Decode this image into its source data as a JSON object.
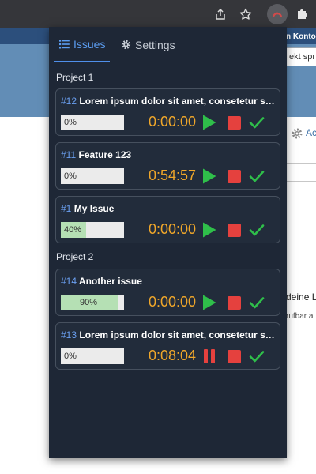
{
  "browser": {
    "icons": [
      "share-icon",
      "star-icon",
      "extension-icon",
      "puzzle-icon"
    ]
  },
  "page": {
    "header_link": "n Konto",
    "search_value": "ekt spr",
    "settings_link": "Ac",
    "text_line1": "deine L",
    "text_line2": "rufbar a"
  },
  "tabs": {
    "issues": "Issues",
    "settings": "Settings"
  },
  "projects": [
    {
      "name": "Project 1",
      "issues": [
        {
          "number": "#12",
          "title": "Lorem ipsum dolor sit amet, consetetur sadipscing elitr",
          "progress": 0,
          "progress_label": "0%",
          "time": "0:00:00",
          "running": false
        },
        {
          "number": "#11",
          "title": "Feature 123",
          "progress": 0,
          "progress_label": "0%",
          "time": "0:54:57",
          "running": false
        },
        {
          "number": "#1",
          "title": "My Issue",
          "progress": 40,
          "progress_label": "40%",
          "time": "0:00:00",
          "running": false
        }
      ]
    },
    {
      "name": "Project 2",
      "issues": [
        {
          "number": "#14",
          "title": "Another issue",
          "progress": 90,
          "progress_label": "90%",
          "time": "0:00:00",
          "running": false
        },
        {
          "number": "#13",
          "title": "Lorem ipsum dolor sit amet, consetetur sadipscing elitr",
          "progress": 0,
          "progress_label": "0%",
          "time": "0:08:04",
          "running": true
        }
      ]
    }
  ],
  "colors": {
    "popup_bg": "#1e2736",
    "card_bg": "#222c3b",
    "accent_blue": "#5b9cf0",
    "timer": "#f0a72a",
    "play": "#2fbf4a",
    "stop": "#e5413e",
    "done": "#2fbf4a",
    "progress_fill": "#b5e0b4"
  }
}
